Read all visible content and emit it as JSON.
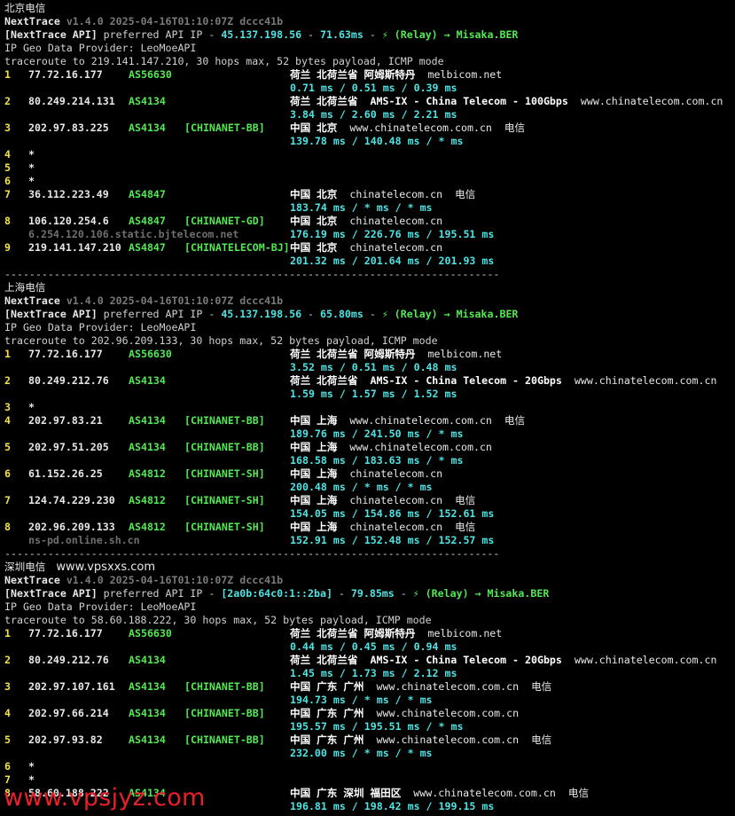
{
  "sections": [
    {
      "label": "北京电信",
      "extra": "",
      "version_prefix": "NextTrace",
      "version": "v1.4.0 2025-04-16T01:10:07Z dccc41b",
      "api_line": {
        "tag": "[NextTrace API]",
        "text": " preferred API IP - ",
        "ip": "45.137.198.56",
        "sep1": " - ",
        "latency": "71.63ms",
        "sep2": " - ",
        "relay": "⚡ (Relay) → Misaka.BER"
      },
      "provider": "IP Geo Data Provider: LeoMoeAPI",
      "traceroute": "traceroute to 219.141.147.210, 30 hops max, 52 bytes payload, ICMP mode",
      "hops": [
        {
          "n": "1",
          "ip": "77.72.16.177",
          "as": "AS56630",
          "tag": "",
          "geo": "荷兰 北荷兰省 阿姆斯特丹",
          "domain": "melbicom.net",
          "isp": "",
          "rtt": "0.71 ms / 0.51 ms / 0.39 ms",
          "rdns": ""
        },
        {
          "n": "2",
          "ip": "80.249.214.131",
          "as": "AS4134",
          "tag": "",
          "geo": "荷兰 北荷兰省  AMS-IX - China Telecom - 100Gbps",
          "domain": "www.chinatelecom.com.cn",
          "isp": "",
          "rtt": "3.84 ms / 2.60 ms / 2.21 ms",
          "rdns": ""
        },
        {
          "n": "3",
          "ip": "202.97.83.225",
          "as": "AS4134",
          "tag": "[CHINANET-BB]",
          "geo": "中国 北京",
          "domain": "www.chinatelecom.com.cn",
          "isp": "电信",
          "rtt": "139.78 ms / 140.48 ms / * ms",
          "rdns": ""
        },
        {
          "n": "4",
          "ip": "*",
          "as": "",
          "tag": "",
          "geo": "",
          "domain": "",
          "isp": "",
          "rtt": "",
          "rdns": ""
        },
        {
          "n": "5",
          "ip": "*",
          "as": "",
          "tag": "",
          "geo": "",
          "domain": "",
          "isp": "",
          "rtt": "",
          "rdns": ""
        },
        {
          "n": "6",
          "ip": "*",
          "as": "",
          "tag": "",
          "geo": "",
          "domain": "",
          "isp": "",
          "rtt": "",
          "rdns": ""
        },
        {
          "n": "7",
          "ip": "36.112.223.49",
          "as": "AS4847",
          "tag": "",
          "geo": "中国 北京",
          "domain": "chinatelecom.cn",
          "isp": "电信",
          "rtt": "183.74 ms / * ms / * ms",
          "rdns": ""
        },
        {
          "n": "8",
          "ip": "106.120.254.6",
          "as": "AS4847",
          "tag": "[CHINANET-GD]",
          "geo": "中国 北京",
          "domain": "chinatelecom.cn",
          "isp": "",
          "rtt": "176.19 ms / 226.76 ms / 195.51 ms",
          "rdns": "6.254.120.106.static.bjtelecom.net"
        },
        {
          "n": "9",
          "ip": "219.141.147.210",
          "as": "AS4847",
          "tag": "[CHINATELECOM-BJ]",
          "geo": "中国 北京",
          "domain": "chinatelecom.cn",
          "isp": "",
          "rtt": "201.32 ms / 201.64 ms / 201.93 ms",
          "rdns": ""
        }
      ]
    },
    {
      "label": "上海电信",
      "extra": "",
      "version_prefix": "NextTrace",
      "version": "v1.4.0 2025-04-16T01:10:07Z dccc41b",
      "api_line": {
        "tag": "[NextTrace API]",
        "text": " preferred API IP - ",
        "ip": "45.137.198.56",
        "sep1": " - ",
        "latency": "65.80ms",
        "sep2": " - ",
        "relay": "⚡ (Relay) → Misaka.BER"
      },
      "provider": "IP Geo Data Provider: LeoMoeAPI",
      "traceroute": "traceroute to 202.96.209.133, 30 hops max, 52 bytes payload, ICMP mode",
      "hops": [
        {
          "n": "1",
          "ip": "77.72.16.177",
          "as": "AS56630",
          "tag": "",
          "geo": "荷兰 北荷兰省 阿姆斯特丹",
          "domain": "melbicom.net",
          "isp": "",
          "rtt": "3.52 ms / 0.51 ms / 0.48 ms",
          "rdns": ""
        },
        {
          "n": "2",
          "ip": "80.249.212.76",
          "as": "AS4134",
          "tag": "",
          "geo": "荷兰 北荷兰省  AMS-IX - China Telecom - 20Gbps",
          "domain": "www.chinatelecom.com.cn",
          "isp": "",
          "rtt": "1.59 ms / 1.57 ms / 1.52 ms",
          "rdns": ""
        },
        {
          "n": "3",
          "ip": "*",
          "as": "",
          "tag": "",
          "geo": "",
          "domain": "",
          "isp": "",
          "rtt": "",
          "rdns": ""
        },
        {
          "n": "4",
          "ip": "202.97.83.21",
          "as": "AS4134",
          "tag": "[CHINANET-BB]",
          "geo": "中国 上海",
          "domain": "www.chinatelecom.com.cn",
          "isp": "电信",
          "rtt": "189.76 ms / 241.50 ms / * ms",
          "rdns": ""
        },
        {
          "n": "5",
          "ip": "202.97.51.205",
          "as": "AS4134",
          "tag": "[CHINANET-BB]",
          "geo": "中国 上海",
          "domain": "www.chinatelecom.com.cn",
          "isp": "",
          "rtt": "168.58 ms / 183.63 ms / * ms",
          "rdns": ""
        },
        {
          "n": "6",
          "ip": "61.152.26.25",
          "as": "AS4812",
          "tag": "[CHINANET-SH]",
          "geo": "中国 上海",
          "domain": "chinatelecom.cn",
          "isp": "",
          "rtt": "200.48 ms / * ms / * ms",
          "rdns": ""
        },
        {
          "n": "7",
          "ip": "124.74.229.230",
          "as": "AS4812",
          "tag": "[CHINANET-SH]",
          "geo": "中国 上海",
          "domain": "chinatelecom.cn",
          "isp": "电信",
          "rtt": "154.05 ms / 154.86 ms / 152.61 ms",
          "rdns": ""
        },
        {
          "n": "8",
          "ip": "202.96.209.133",
          "as": "AS4812",
          "tag": "[CHINANET-SH]",
          "geo": "中国 上海",
          "domain": "chinatelecom.cn",
          "isp": "电信",
          "rtt": "152.91 ms / 152.48 ms / 152.57 ms",
          "rdns": "ns-pd.online.sh.cn"
        }
      ]
    },
    {
      "label": "深圳电信",
      "extra": "www.vpsxxs.com",
      "version_prefix": "NextTrace",
      "version": "v1.4.0 2025-04-16T01:10:07Z dccc41b",
      "api_line": {
        "tag": "[NextTrace API]",
        "text": " preferred API IP - ",
        "ip": "[2a0b:64c0:1::2ba]",
        "sep1": " - ",
        "latency": "79.85ms",
        "sep2": " - ",
        "relay": "⚡ (Relay) → Misaka.BER"
      },
      "provider": "IP Geo Data Provider: LeoMoeAPI",
      "traceroute": "traceroute to 58.60.188.222, 30 hops max, 52 bytes payload, ICMP mode",
      "hops": [
        {
          "n": "1",
          "ip": "77.72.16.177",
          "as": "AS56630",
          "tag": "",
          "geo": "荷兰 北荷兰省 阿姆斯特丹",
          "domain": "melbicom.net",
          "isp": "",
          "rtt": "0.44 ms / 0.45 ms / 0.94 ms",
          "rdns": ""
        },
        {
          "n": "2",
          "ip": "80.249.212.76",
          "as": "AS4134",
          "tag": "",
          "geo": "荷兰 北荷兰省  AMS-IX - China Telecom - 20Gbps",
          "domain": "www.chinatelecom.com.cn",
          "isp": "",
          "rtt": "1.45 ms / 1.73 ms / 2.12 ms",
          "rdns": ""
        },
        {
          "n": "3",
          "ip": "202.97.107.161",
          "as": "AS4134",
          "tag": "[CHINANET-BB]",
          "geo": "中国 广东 广州",
          "domain": "www.chinatelecom.com.cn",
          "isp": "电信",
          "rtt": "194.73 ms / * ms / * ms",
          "rdns": ""
        },
        {
          "n": "4",
          "ip": "202.97.66.214",
          "as": "AS4134",
          "tag": "[CHINANET-BB]",
          "geo": "中国 广东 广州",
          "domain": "www.chinatelecom.com.cn",
          "isp": "",
          "rtt": "195.57 ms / 195.51 ms / * ms",
          "rdns": ""
        },
        {
          "n": "5",
          "ip": "202.97.93.82",
          "as": "AS4134",
          "tag": "[CHINANET-BB]",
          "geo": "中国 广东 广州",
          "domain": "www.chinatelecom.com.cn",
          "isp": "电信",
          "rtt": "232.00 ms / * ms / * ms",
          "rdns": ""
        },
        {
          "n": "6",
          "ip": "*",
          "as": "",
          "tag": "",
          "geo": "",
          "domain": "",
          "isp": "",
          "rtt": "",
          "rdns": ""
        },
        {
          "n": "7",
          "ip": "*",
          "as": "",
          "tag": "",
          "geo": "",
          "domain": "",
          "isp": "",
          "rtt": "",
          "rdns": ""
        },
        {
          "n": "8",
          "ip": "58.60.188.222",
          "as": "AS4134",
          "tag": "",
          "geo": "中国 广东 深圳 福田区",
          "domain": "www.chinatelecom.com.cn",
          "isp": "电信",
          "rtt": "196.81 ms / 198.42 ms / 199.15 ms",
          "rdns": ""
        }
      ]
    }
  ],
  "separator": "--------------------------------------------------------------------------------",
  "watermark": "www.vpsjyz.com"
}
